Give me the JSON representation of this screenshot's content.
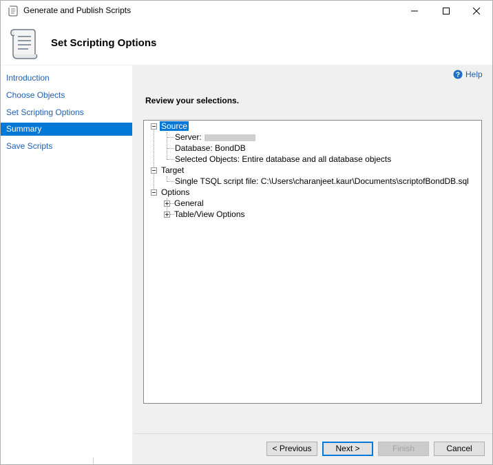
{
  "window": {
    "title": "Generate and Publish Scripts",
    "minimize_glyph": "—",
    "maximize_glyph": "☐",
    "close_glyph": "✕"
  },
  "header": {
    "title": "Set Scripting Options"
  },
  "nav": {
    "items": [
      {
        "label": "Introduction",
        "selected": false
      },
      {
        "label": "Choose Objects",
        "selected": false
      },
      {
        "label": "Set Scripting Options",
        "selected": false
      },
      {
        "label": "Summary",
        "selected": true
      },
      {
        "label": "Save Scripts",
        "selected": false
      }
    ]
  },
  "main": {
    "help_label": "Help",
    "heading": "Review your selections."
  },
  "tree": {
    "source": {
      "label": "Source",
      "server_label": "Server:",
      "database": "Database: BondDB",
      "selected_objects": "Selected Objects: Entire database and all database objects"
    },
    "target": {
      "label": "Target",
      "script_file": "Single TSQL script file: C:\\Users\\charanjeet.kaur\\Documents\\scriptofBondDB.sql"
    },
    "options": {
      "label": "Options",
      "general": "General",
      "table_view": "Table/View Options"
    }
  },
  "buttons": {
    "previous": "< Previous",
    "next": "Next >",
    "finish": "Finish",
    "cancel": "Cancel"
  },
  "colors": {
    "accent": "#0078d7",
    "link": "#1c5fb4"
  }
}
